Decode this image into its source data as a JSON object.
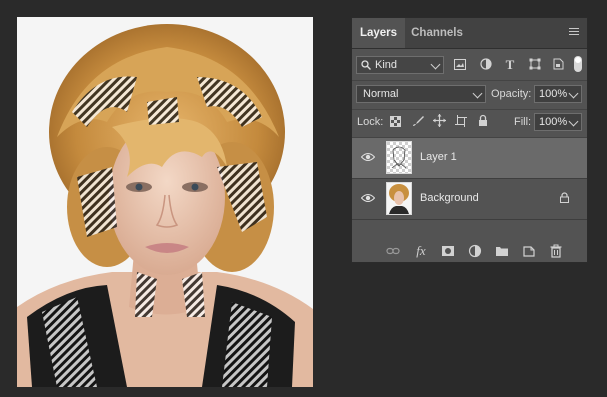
{
  "panel": {
    "tabs": [
      {
        "label": "Layers",
        "active": true
      },
      {
        "label": "Channels",
        "active": false
      }
    ],
    "filter": {
      "kind_label": "Kind"
    },
    "blend": {
      "mode": "Normal",
      "opacity_label": "Opacity:",
      "opacity_value": "100%"
    },
    "lock": {
      "label": "Lock:",
      "fill_label": "Fill:",
      "fill_value": "100%"
    },
    "layers": [
      {
        "name": "Layer 1",
        "selected": true,
        "visible": true,
        "locked": false
      },
      {
        "name": "Background",
        "selected": false,
        "visible": true,
        "locked": true
      }
    ]
  },
  "colors": {
    "app_bg": "#2a2a2a",
    "panel_bg": "#535353",
    "selected_row": "#6a6a6a"
  }
}
